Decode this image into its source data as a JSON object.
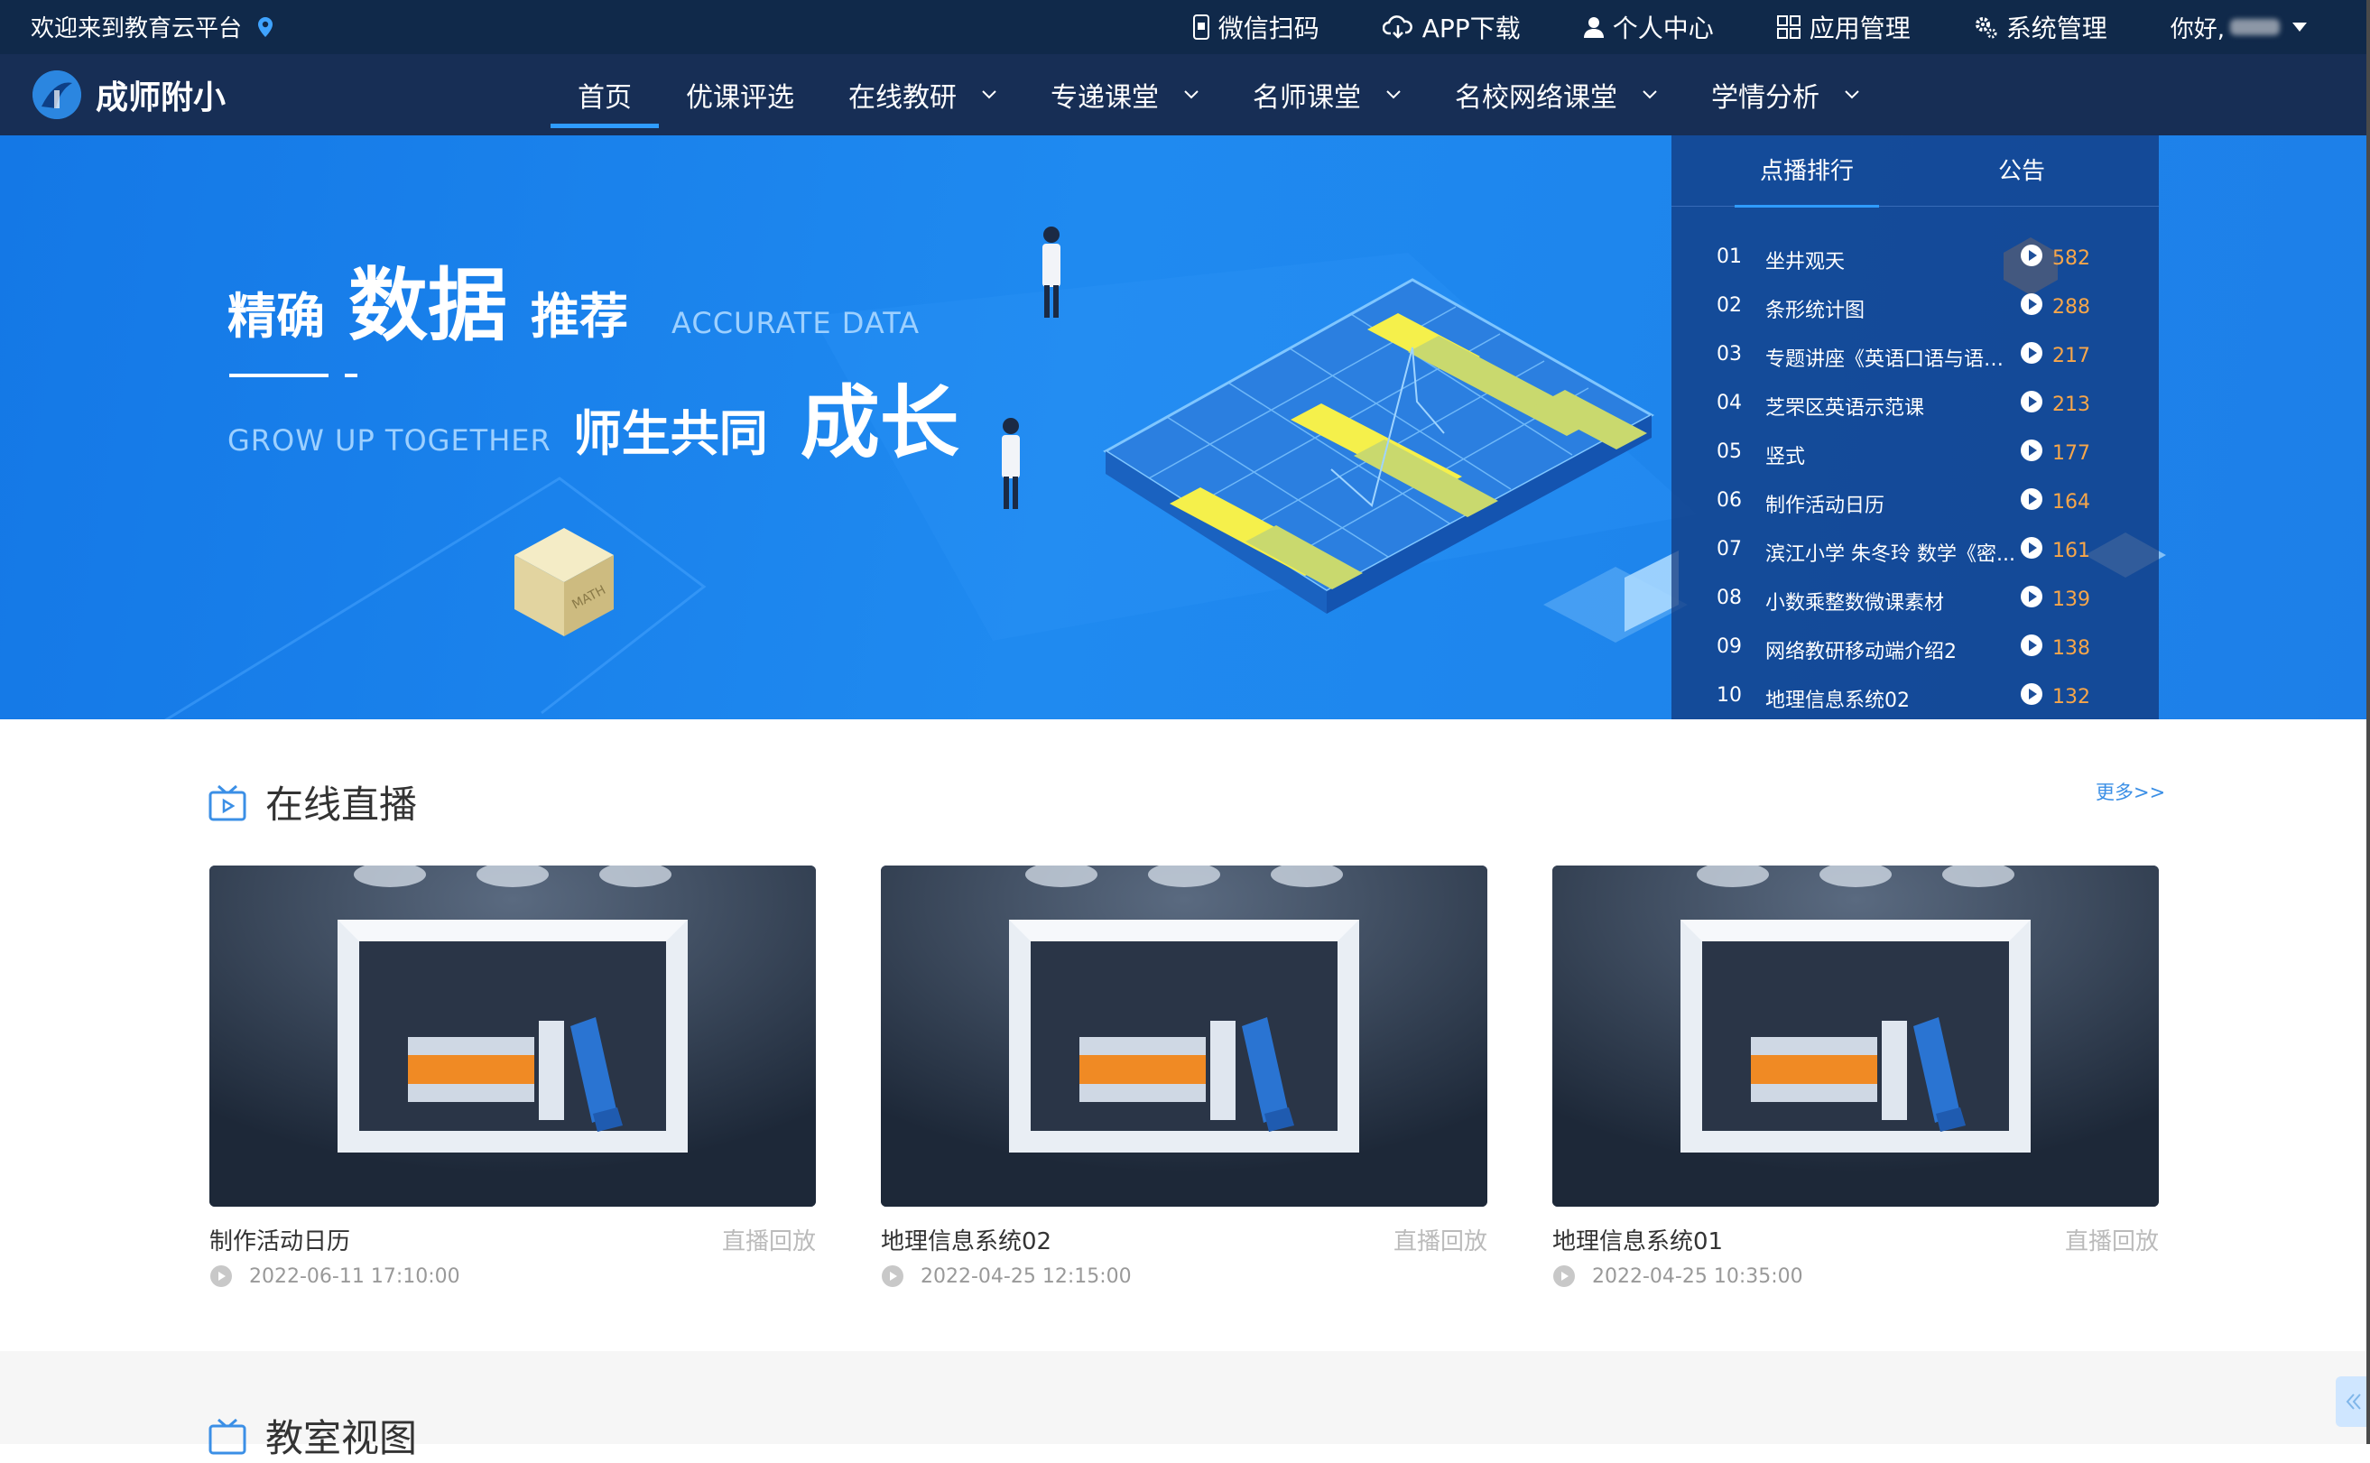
{
  "topbar": {
    "welcome": "欢迎来到教育云平台",
    "links": [
      {
        "label": "微信扫码",
        "icon": "phone-qr-icon"
      },
      {
        "label": "APP下载",
        "icon": "cloud-download-icon"
      },
      {
        "label": "个人中心",
        "icon": "user-icon"
      },
      {
        "label": "应用管理",
        "icon": "apps-grid-icon"
      },
      {
        "label": "系统管理",
        "icon": "gear-icon"
      }
    ],
    "greeting": "你好,"
  },
  "nav": {
    "logo_text": "成师附小",
    "items": [
      {
        "label": "首页",
        "dropdown": false,
        "active": true
      },
      {
        "label": "优课评选",
        "dropdown": false
      },
      {
        "label": "在线教研",
        "dropdown": true
      },
      {
        "label": "专递课堂",
        "dropdown": true
      },
      {
        "label": "名师课堂",
        "dropdown": true
      },
      {
        "label": "名校网络课堂",
        "dropdown": true
      },
      {
        "label": "学情分析",
        "dropdown": true
      }
    ]
  },
  "banner": {
    "line1_a": "精确",
    "line1_b": "数据",
    "line1_c": "推荐",
    "line1_en": "ACCURATE DATA",
    "line2_en": "GROW UP TOGETHER",
    "line2_a": "师生共同",
    "line2_b": "成长",
    "box_label": "MATH"
  },
  "ranking": {
    "tabs": [
      "点播排行",
      "公告"
    ],
    "items": [
      {
        "no": "01",
        "title": "坐井观天",
        "count": "582"
      },
      {
        "no": "02",
        "title": "条形统计图",
        "count": "288"
      },
      {
        "no": "03",
        "title": "专题讲座《英语口语与语言...",
        "count": "217"
      },
      {
        "no": "04",
        "title": "芝罘区英语示范课",
        "count": "213"
      },
      {
        "no": "05",
        "title": "竖式",
        "count": "177"
      },
      {
        "no": "06",
        "title": "制作活动日历",
        "count": "164"
      },
      {
        "no": "07",
        "title": "滨江小学 朱冬玲 数学《密...",
        "count": "161"
      },
      {
        "no": "08",
        "title": "小数乘整数微课素材",
        "count": "139"
      },
      {
        "no": "09",
        "title": "网络教研移动端介绍2",
        "count": "138"
      },
      {
        "no": "10",
        "title": "地理信息系统02",
        "count": "132"
      }
    ]
  },
  "live": {
    "title": "在线直播",
    "more": "更多>>",
    "cards": [
      {
        "title": "制作活动日历",
        "tag": "直播回放",
        "time": "2022-06-11 17:10:00"
      },
      {
        "title": "地理信息系统02",
        "tag": "直播回放",
        "time": "2022-04-25 12:15:00"
      },
      {
        "title": "地理信息系统01",
        "tag": "直播回放",
        "time": "2022-04-25 10:35:00"
      }
    ]
  },
  "classroom": {
    "title": "教室视图"
  },
  "colors": {
    "topbar": "#10294a",
    "navbar": "#172e55",
    "accent": "#2f9cff",
    "count": "#f7a64a"
  }
}
